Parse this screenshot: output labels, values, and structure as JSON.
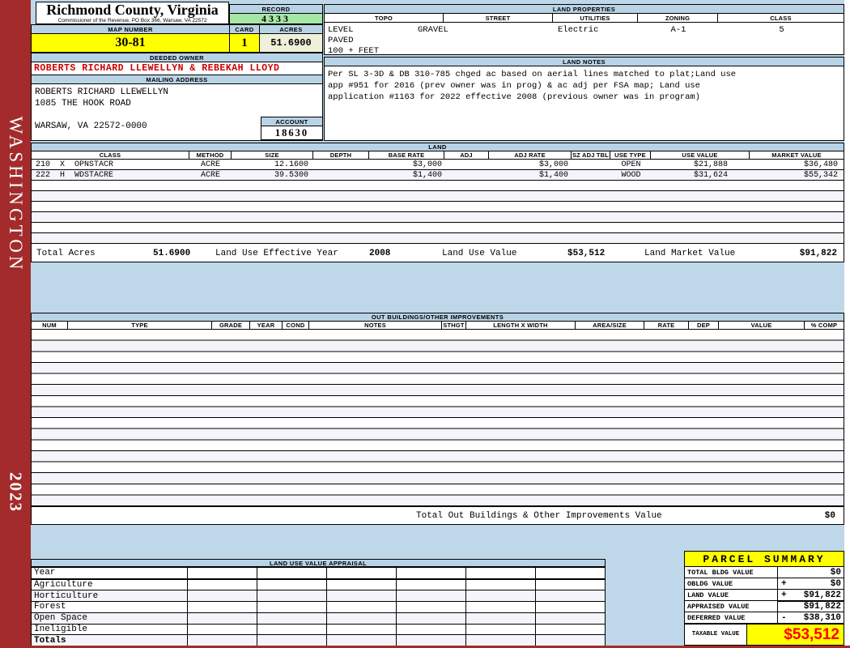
{
  "sidebar": {
    "district": "WASHINGTON",
    "year": "2023"
  },
  "header": {
    "county": "Richmond County, Virginia",
    "commissioner": "Commissioner of the Revenue, PO Box 366, Warsaw, VA 22572",
    "record_label": "RECORD",
    "record_value": "4333",
    "map_number_label": "MAP NUMBER",
    "map_number": "30-81",
    "card_label": "CARD",
    "card": "1",
    "acres_label": "ACRES",
    "acres": "51.6900",
    "deeded_owner_label": "DEEDED OWNER",
    "deeded_owner": "ROBERTS RICHARD LLEWELLYN & REBEKAH LLOYD",
    "mailing_address_label": "MAILING ADDRESS",
    "address_line1": "ROBERTS RICHARD LLEWELLYN",
    "address_line2": "1085 THE HOOK ROAD",
    "address_line3": "WARSAW, VA 22572-0000",
    "account_label": "ACCOUNT",
    "account": "18630"
  },
  "land_properties": {
    "title": "LAND PROPERTIES",
    "columns": [
      "TOPO",
      "STREET",
      "UTILITIES",
      "ZONING",
      "CLASS"
    ],
    "topo": [
      "LEVEL",
      "PAVED",
      "100 + FEET"
    ],
    "street": "GRAVEL",
    "utilities": "Electric",
    "zoning": "A-1",
    "class": "5"
  },
  "land_notes": {
    "title": "LAND NOTES",
    "lines": [
      "Per SL 3-3D & DB 310-785 chged ac based on aerial lines matched to plat;Land use",
      "app #951 for 2016 (prev owner was in prog) & ac adj per FSA map; Land use",
      "application #1163 for 2022 effective 2008 (previous owner was in program)"
    ]
  },
  "land_table": {
    "title": "LAND",
    "columns": [
      "CLASS",
      "METHOD",
      "SIZE",
      "DEPTH",
      "BASE RATE",
      "ADJ",
      "ADJ RATE",
      "SZ ADJ TBL",
      "USE TYPE",
      "USE VALUE",
      "MARKET VALUE"
    ],
    "rows": [
      {
        "class": "210  X  OPNSTACR",
        "method": "ACRE",
        "size": "12.1600",
        "depth": "",
        "base_rate": "$3,000",
        "adj": "",
        "adj_rate": "$3,000",
        "sz_adj_tbl": "",
        "use_type": "OPEN",
        "use_value": "$21,888",
        "market_value": "$36,480"
      },
      {
        "class": "222  H  WDSTACRE",
        "method": "ACRE",
        "size": "39.5300",
        "depth": "",
        "base_rate": "$1,400",
        "adj": "",
        "adj_rate": "$1,400",
        "sz_adj_tbl": "",
        "use_type": "WOOD",
        "use_value": "$31,624",
        "market_value": "$55,342"
      }
    ],
    "totals": {
      "total_acres_label": "Total Acres",
      "total_acres": "51.6900",
      "effective_year_label": "Land Use Effective Year",
      "effective_year": "2008",
      "use_value_label": "Land Use Value",
      "use_value": "$53,512",
      "market_value_label": "Land Market Value",
      "market_value": "$91,822"
    }
  },
  "out_buildings": {
    "title": "OUT BUILDINGS/OTHER IMPROVEMENTS",
    "columns": [
      "NUM",
      "TYPE",
      "GRADE",
      "YEAR",
      "COND",
      "NOTES",
      "STHGT",
      "LENGTH X WIDTH",
      "AREA/SIZE",
      "RATE",
      "DEP",
      "VALUE",
      "% COMP"
    ],
    "total_label": "Total Out Buildings & Other Improvements Value",
    "total_value": "$0"
  },
  "appraisal": {
    "title": "LAND USE VALUE APPRAISAL",
    "row_labels": [
      "Year",
      "Agriculture",
      "Horticulture",
      "Forest",
      "Open Space",
      "Ineligible",
      "Totals"
    ]
  },
  "parcel_summary": {
    "title": "PARCEL SUMMARY",
    "rows": [
      {
        "label": "TOTAL BLDG VALUE",
        "op": "",
        "value": "$0"
      },
      {
        "label": "OBLDG VALUE",
        "op": "+",
        "value": "$0"
      },
      {
        "label": "LAND VALUE",
        "op": "+",
        "value": "$91,822"
      },
      {
        "label": "APPRAISED VALUE",
        "op": "",
        "value": "$91,822"
      },
      {
        "label": "DEFERRED VALUE",
        "op": "-",
        "value": "$38,310"
      }
    ],
    "taxable_label": "TAXABLE VALUE",
    "taxable_value": "$53,512"
  },
  "colors": {
    "sidebar_red": "#A32B2B",
    "header_blue": "#B9D3E6",
    "highlight_yellow": "#FFFF00",
    "record_green": "#A5E7A5",
    "acres_cream": "#F0EFD9",
    "owner_red": "#CC0000",
    "taxable_red": "#FF0000"
  }
}
